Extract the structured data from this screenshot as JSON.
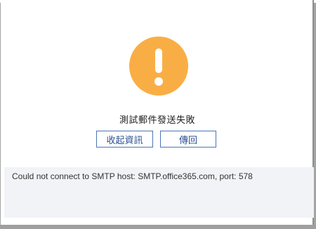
{
  "dialog": {
    "title": "測試郵件發送失敗",
    "icon": "warning-exclamation-icon",
    "icon_color": "#f9ae45",
    "buttons": {
      "info_label": "收起資訊",
      "back_label": "傳回"
    },
    "message": "Could not connect to SMTP host: SMTP.office365.com, port: 578"
  }
}
